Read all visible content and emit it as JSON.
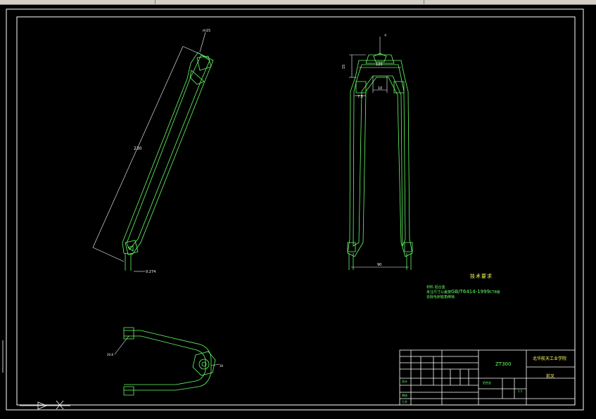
{
  "drawing": {
    "dimensions": {
      "top_label": "m15",
      "length": "230",
      "tip": "0.274",
      "width_top": "120",
      "height_left": "15",
      "inner": "10",
      "left_small": "7.5",
      "bottom_width": "90",
      "plan_left": "20.8",
      "plan_right": "30"
    },
    "technical_requirements": {
      "title": "技术要求",
      "line1": "材料 铝合金",
      "line2_prefix": "未注尺寸公差按",
      "line2_standard": "GB/T6414-1999",
      "line2_suffix": "CT8级",
      "line3": "去除毛刺锐角倒钝"
    },
    "title_block": {
      "drawing_number": "ZT300",
      "school": "北华航天工业学院",
      "part_name": "前叉",
      "material": "铝合金",
      "scale": "1:1",
      "design_label": "设计",
      "check_label": "审核",
      "process_label": "工艺"
    }
  },
  "colors": {
    "background": "#000000",
    "frame": "#ffffff",
    "part_lines": "#66ff66",
    "dimension_lines": "#ffffff",
    "text_yellow": "#ffff66"
  }
}
